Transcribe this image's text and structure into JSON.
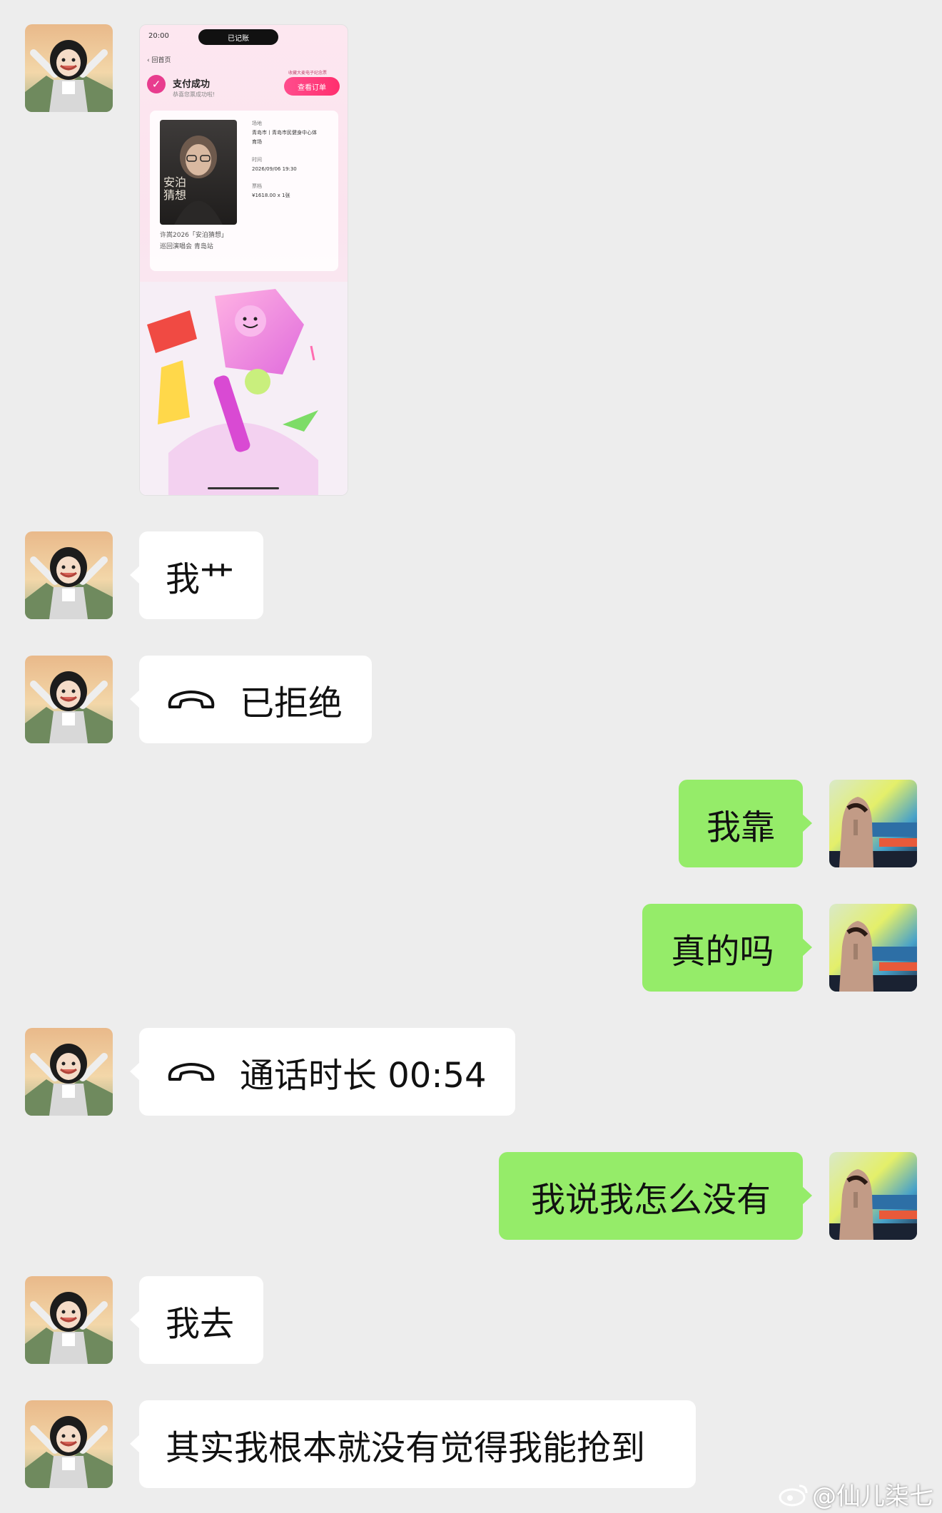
{
  "image_message": {
    "status_time": "20:00",
    "island_text": "已记账",
    "back_label": "回首页",
    "pay_title": "支付成功",
    "pay_subtitle": "恭喜您票成功啦!",
    "order_tag": "收藏大麦电子纪念票",
    "order_button": "查看订单",
    "poster_title": "安泊\n猜想",
    "concert_name": "许嵩2026「安泊猜想」\n巡回演唱会 青岛站",
    "venue_label": "场地",
    "venue": "青岛市丨青岛市民健身中心体\n育场",
    "time_label": "时间",
    "time": "2026/09/06 19:30",
    "price_label": "票档",
    "price": "¥1618.00 x 1张"
  },
  "messages": [
    {
      "side": "left",
      "text": "我艹"
    },
    {
      "side": "left",
      "type": "call",
      "text": "已拒绝"
    },
    {
      "side": "right",
      "text": "我靠"
    },
    {
      "side": "right",
      "text": "真的吗"
    },
    {
      "side": "left",
      "type": "call",
      "text": "通话时长 00:54"
    },
    {
      "side": "right",
      "text": "我说我怎么没有"
    },
    {
      "side": "left",
      "text": "我去"
    },
    {
      "side": "left",
      "text": "其实我根本就没有觉得我能抢到"
    }
  ],
  "watermark": "@仙儿柒七",
  "colors": {
    "background": "#ededed",
    "left_bubble": "#ffffff",
    "right_bubble": "#95ec69"
  },
  "icons": {
    "call": "phone-handset-icon",
    "watermark": "weibo-icon"
  }
}
